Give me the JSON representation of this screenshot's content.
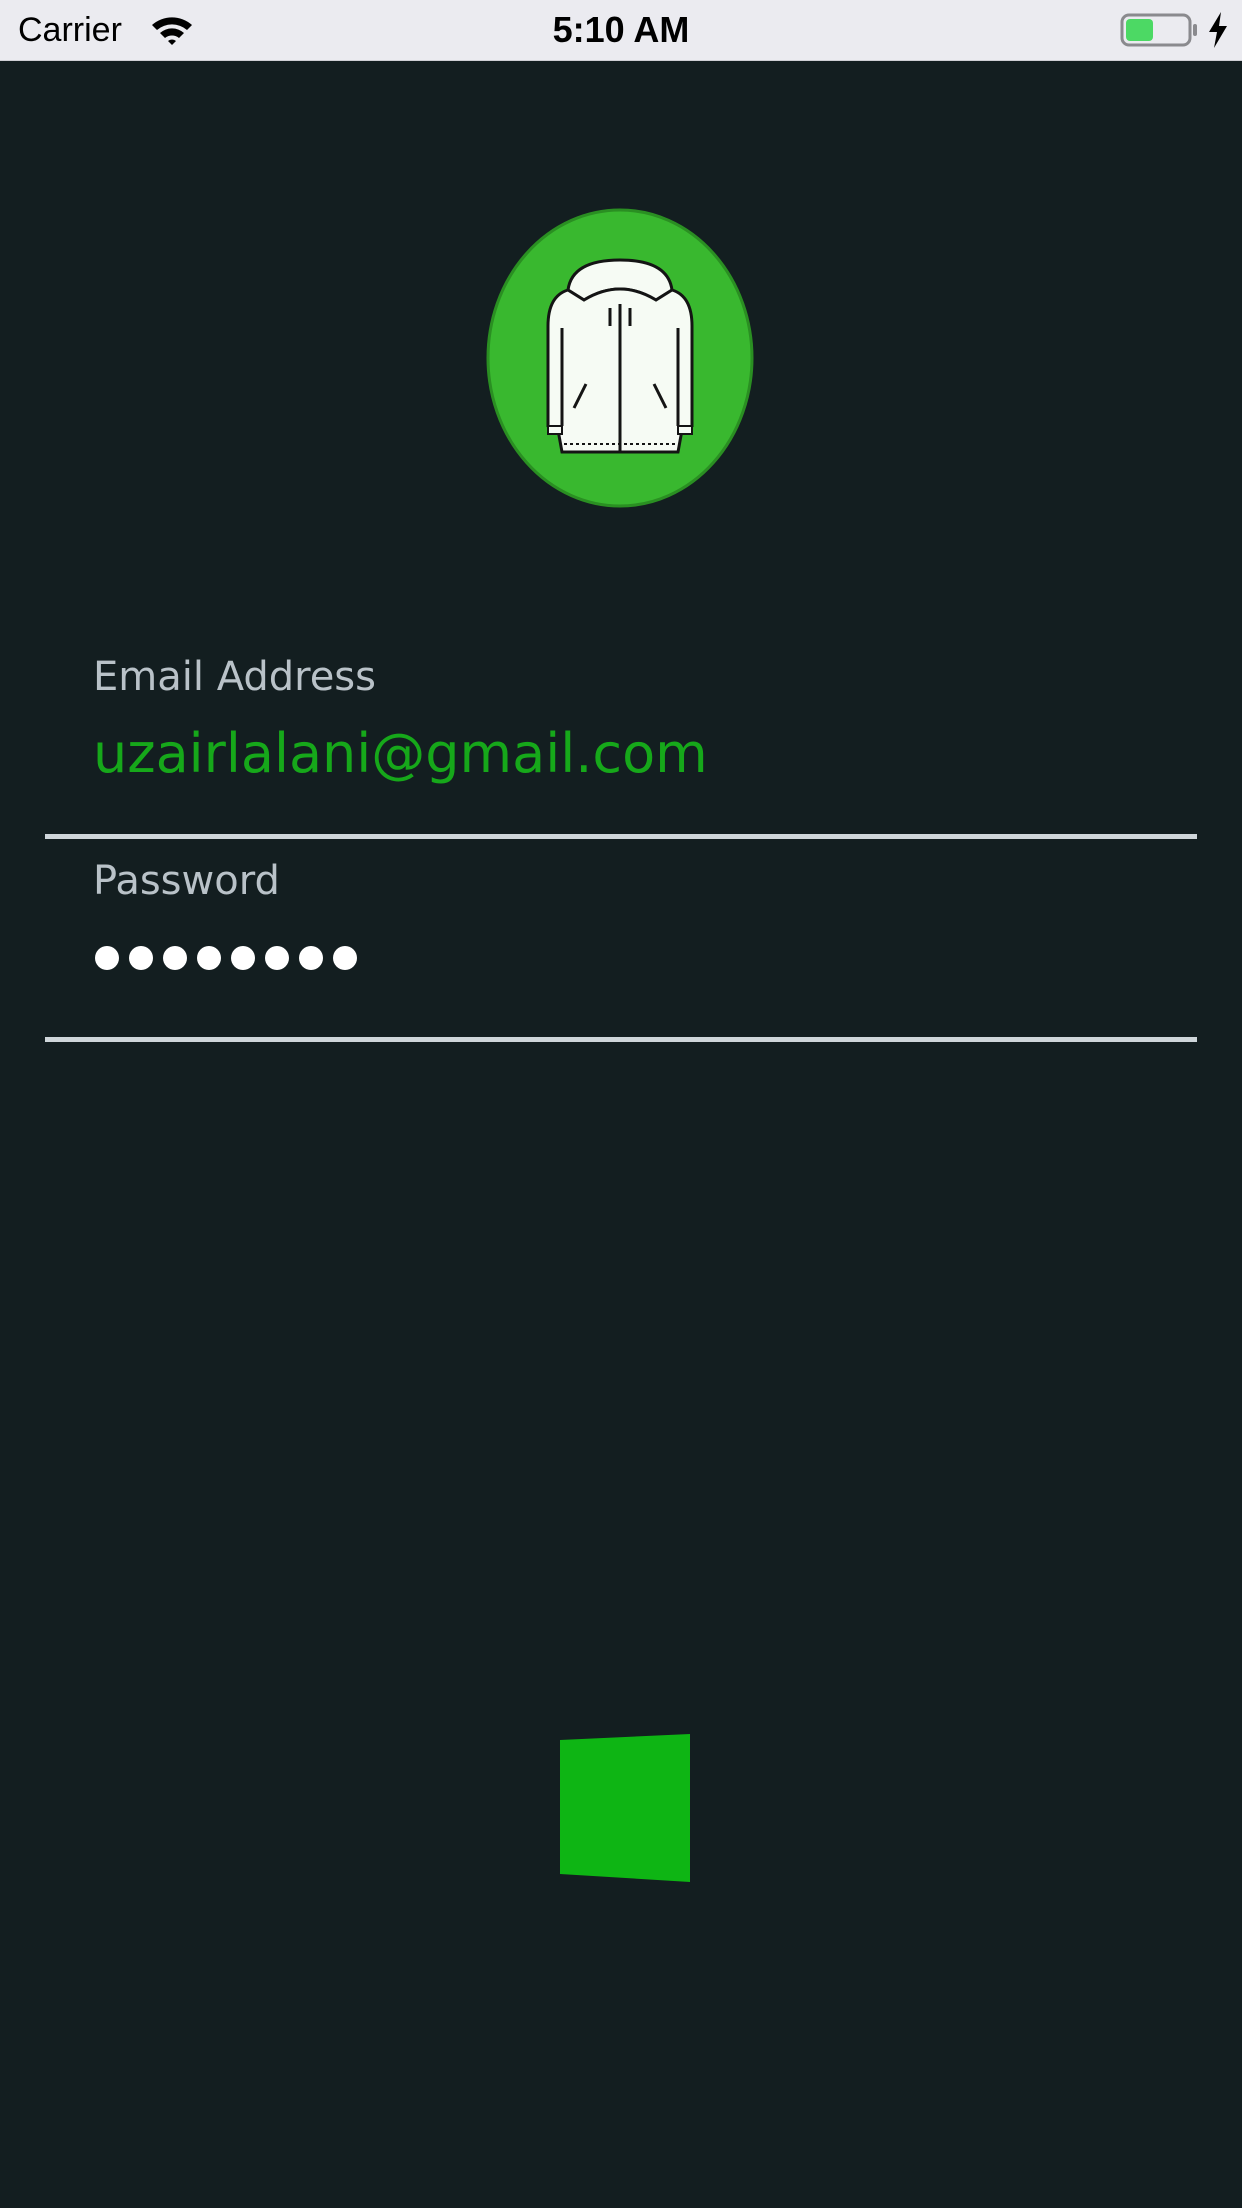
{
  "status_bar": {
    "carrier": "Carrier",
    "time": "5:10 AM",
    "battery_level": 0.45,
    "charging": true
  },
  "logo": {
    "icon": "hoodie-icon",
    "background_color": "#39b82f"
  },
  "form": {
    "email": {
      "label": "Email Address",
      "value": "uzairlalani@gmail.com"
    },
    "password": {
      "label": "Password",
      "masked_length": 8
    }
  },
  "submit": {
    "icon": "green-square-icon",
    "color": "#0eb514"
  },
  "colors": {
    "background": "#131e20",
    "accent": "#16a81a",
    "label": "#b9c2c8",
    "divider": "#cfd6da"
  }
}
